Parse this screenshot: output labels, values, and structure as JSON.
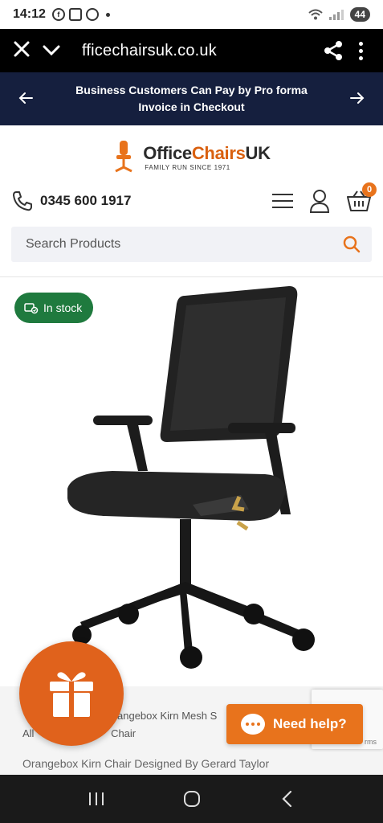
{
  "status_bar": {
    "time": "14:12",
    "battery": "44"
  },
  "browser": {
    "url": "fficechairsuk.co.uk",
    "close_icon": "close-icon",
    "chevron_icon": "chevron-down-icon",
    "share_icon": "share-icon",
    "more_icon": "more-vertical-icon"
  },
  "promo": {
    "text_line1": "Business Customers Can Pay by Pro forma",
    "text_line2": "Invoice in Checkout"
  },
  "logo": {
    "name_part1": "Office",
    "name_part2": "Chairs",
    "name_part3": "UK",
    "tagline": "FAMILY RUN SINCE 1971"
  },
  "header": {
    "phone": "0345 600 1917",
    "basket_count": "0"
  },
  "search": {
    "placeholder": "Search Products"
  },
  "product": {
    "stock_status": "In stock",
    "breadcrumb_fragment1": "angebox Kirn Mesh S",
    "breadcrumb_fragment2": "All ",
    "breadcrumb_fragment3": "Chair",
    "description_partial": "Orangebox Kirn Chair Designed By Gerard Taylor"
  },
  "help_button": {
    "label": "Need help?"
  },
  "recaptcha": {
    "terms_fragment": "rms"
  },
  "colors": {
    "accent_orange": "#e8731c",
    "promo_navy": "#151f3e",
    "stock_green": "#1f7a3e"
  }
}
